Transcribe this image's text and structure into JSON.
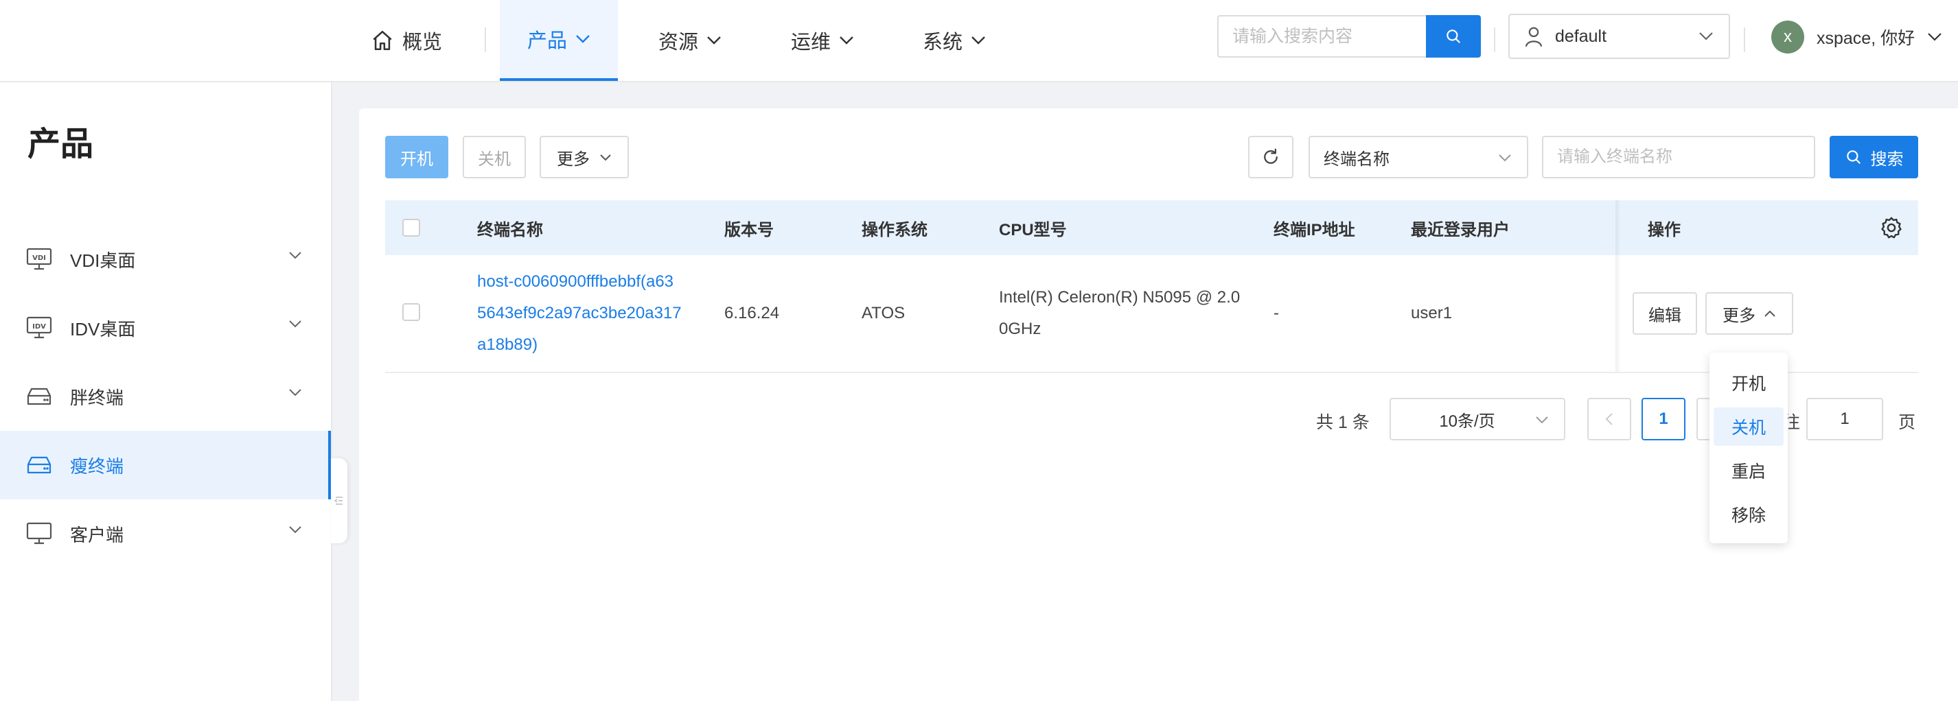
{
  "nav": {
    "items": [
      {
        "label": "概览",
        "icon": "home-icon"
      },
      {
        "label": "产品",
        "active": true
      },
      {
        "label": "资源"
      },
      {
        "label": "运维"
      },
      {
        "label": "系统"
      }
    ],
    "search_placeholder": "请输入搜索内容",
    "tenant": "default",
    "user_initial": "x",
    "user_greeting": "xspace, 你好"
  },
  "sidebar": {
    "title": "产品",
    "items": [
      {
        "label": "VDI桌面",
        "icon": "vdi-monitor-icon",
        "badge": "VDI"
      },
      {
        "label": "IDV桌面",
        "icon": "idv-monitor-icon",
        "badge": "IDV"
      },
      {
        "label": "胖终端",
        "icon": "fat-terminal-icon"
      },
      {
        "label": "瘦终端",
        "icon": "thin-terminal-icon",
        "active": true
      },
      {
        "label": "客户端",
        "icon": "desktop-client-icon"
      }
    ]
  },
  "toolbar": {
    "power_on": "开机",
    "power_off": "关机",
    "more": "更多",
    "filter_field": "终端名称",
    "filter_placeholder": "请输入终端名称",
    "search": "搜索"
  },
  "table": {
    "columns": [
      "终端名称",
      "版本号",
      "操作系统",
      "CPU型号",
      "终端IP地址",
      "最近登录用户",
      "操作"
    ],
    "rows": [
      {
        "name_lines": [
          "host-c0060900fffbebbf(a63",
          "5643ef9c2a97ac3be20a317",
          "a18b89)"
        ],
        "version": "6.16.24",
        "os": "ATOS",
        "cpu_lines": [
          "Intel(R) Celeron(R) N5095 @ 2.0",
          "0GHz"
        ],
        "ip": "-",
        "last_user": "user1",
        "edit": "编辑",
        "more": "更多"
      }
    ]
  },
  "pagination": {
    "total": "共 1 条",
    "page_size": "10条/页",
    "current_page": "1",
    "goto_prefix": "往",
    "goto_value": "1",
    "goto_suffix": "页"
  },
  "more_menu": {
    "items": [
      "开机",
      "关机",
      "重启",
      "移除"
    ],
    "active_index": 1
  },
  "colors": {
    "primary": "#1a7de6",
    "primary_light": "#73b7f5",
    "header_bg": "#e8f2fd",
    "active_bg": "#eaf3fd"
  }
}
